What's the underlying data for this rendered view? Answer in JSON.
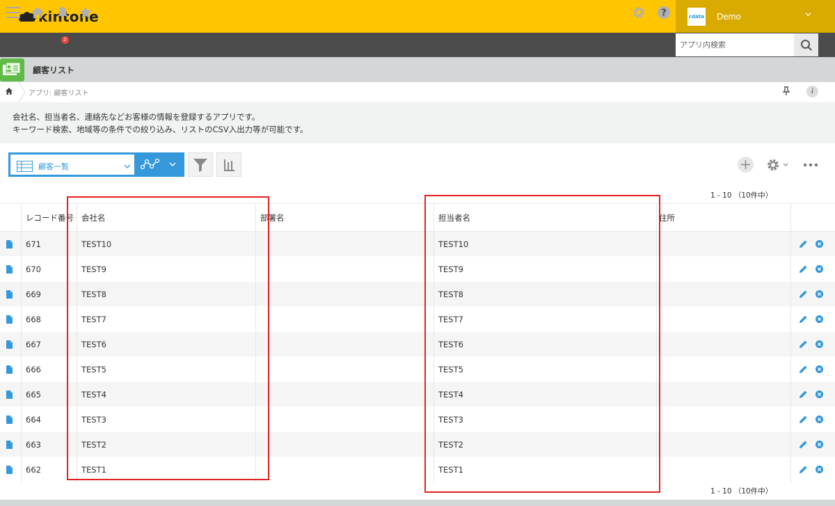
{
  "header": {
    "logo_text": "kintone",
    "user_logo_text": "cdata",
    "user_name": "Demo"
  },
  "nav": {
    "notification_count": "2",
    "search_placeholder": "アプリ内検索"
  },
  "app": {
    "title": "顧客リスト",
    "breadcrumb": "アプリ: 顧客リスト",
    "info_label": "i",
    "description_line1": "会社名、担当者名、連絡先などお客様の情報を登録するアプリです。",
    "description_line2": "キーワード検索、地域等の条件での絞り込み、リストのCSV入出力等が可能です。"
  },
  "toolbar": {
    "view_name": "顧客一覧",
    "pager_top": "1 - 10 （10件中）",
    "pager_bottom": "1 - 10 （10件中）"
  },
  "table": {
    "headers": {
      "record_no": "レコード番号",
      "company": "会社名",
      "department": "部署名",
      "contact": "担当者名",
      "address": "住所"
    },
    "rows": [
      {
        "record_no": "671",
        "company": "TEST10",
        "department": "",
        "contact": "TEST10",
        "address": ""
      },
      {
        "record_no": "670",
        "company": "TEST9",
        "department": "",
        "contact": "TEST9",
        "address": ""
      },
      {
        "record_no": "669",
        "company": "TEST8",
        "department": "",
        "contact": "TEST8",
        "address": ""
      },
      {
        "record_no": "668",
        "company": "TEST7",
        "department": "",
        "contact": "TEST7",
        "address": ""
      },
      {
        "record_no": "667",
        "company": "TEST6",
        "department": "",
        "contact": "TEST6",
        "address": ""
      },
      {
        "record_no": "666",
        "company": "TEST5",
        "department": "",
        "contact": "TEST5",
        "address": ""
      },
      {
        "record_no": "665",
        "company": "TEST4",
        "department": "",
        "contact": "TEST4",
        "address": ""
      },
      {
        "record_no": "664",
        "company": "TEST3",
        "department": "",
        "contact": "TEST3",
        "address": ""
      },
      {
        "record_no": "663",
        "company": "TEST2",
        "department": "",
        "contact": "TEST2",
        "address": ""
      },
      {
        "record_no": "662",
        "company": "TEST1",
        "department": "",
        "contact": "TEST1",
        "address": ""
      }
    ]
  },
  "colors": {
    "header_yellow": "#ffc600",
    "nav_dark": "#4b4b4b",
    "accent_blue": "#3498db",
    "highlight_red": "#e61e1e"
  }
}
